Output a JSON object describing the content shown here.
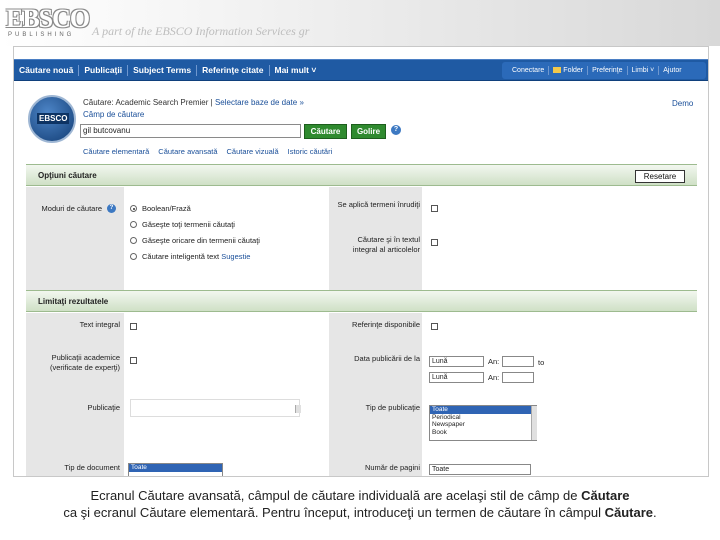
{
  "banner": {
    "logo": "EBSCO",
    "logo_sub": "PUBLISHING",
    "tagline": "A part of the EBSCO Information Services gr"
  },
  "navbar": {
    "items": [
      "Căutare nouă",
      "Publicaţii",
      "Subject Terms",
      "Referinţe citate",
      "Mai mult ˅"
    ],
    "right_items": [
      "Conectare",
      "Folder",
      "Preferinţe",
      "Limbi ˅",
      "Ajutor"
    ]
  },
  "search": {
    "db_logo": "EBSCO",
    "search_in_prefix": "Căutare: Academic Search Premier",
    "choose_db_link": "Selectare baze de date »",
    "select_field": "Câmp de căutare",
    "query": "gil butcovanu",
    "search_button": "Căutare",
    "clear_button": "Golire",
    "help_icon": "?",
    "demo_link": "Demo",
    "sublinks": [
      "Căutare elementară",
      "Căutare avansată",
      "Căutare vizuală",
      "Istoric căutări"
    ]
  },
  "options": {
    "title": "Opţiuni căutare",
    "reset_button": "Resetare",
    "mode_label": "Moduri de căutare",
    "modes": [
      "Boolean/Frază",
      "Găseşte toţi termenii căutaţi",
      "Găseşte oricare din termenii căutaţi",
      "Căutare inteligentă text"
    ],
    "suggestion_link": "Sugestie",
    "selected_mode_index": 0,
    "related_terms_label": "Se aplică termeni înrudiţi",
    "fulltext_search_label": "Căutare şi în textul integral al articolelor"
  },
  "limits": {
    "title": "Limitaţi rezultatele",
    "full_text_label": "Text integral",
    "references_label": "Referinţe disponibile",
    "scholarly_label": "Publicaţii academice (verificate de experţi)",
    "pub_date_label": "Data publicării de la",
    "month_placeholder": "Lună",
    "year_placeholder": "An:",
    "to_label": "to",
    "publication_label": "Publicaţie",
    "pub_type_label": "Tip de publicaţie",
    "pub_types": [
      "Toate",
      "Periodical",
      "Newspaper",
      "Book"
    ],
    "doc_type_label": "Tip de document",
    "doc_type_value": "Toate",
    "pages_label": "Număr de pagini",
    "pages_value": "Toate"
  },
  "caption": {
    "line1_prefix": "Ecranul Căutare avansată, câmpul de căutare individuală are acelaşi stil de câmp de ",
    "line1_bold": "Căutare",
    "line2_prefix": "ca şi ecranul Căutare elementară. Pentru început, introduceţi un termen de căutare în câmpul ",
    "line2_bold": "Căutare",
    "line2_suffix": "."
  },
  "colors": {
    "nav_blue": "#1f5aa3",
    "button_green": "#2f8a2f",
    "section_header_green": "#cfe0c6",
    "link_blue": "#1a4f99"
  }
}
